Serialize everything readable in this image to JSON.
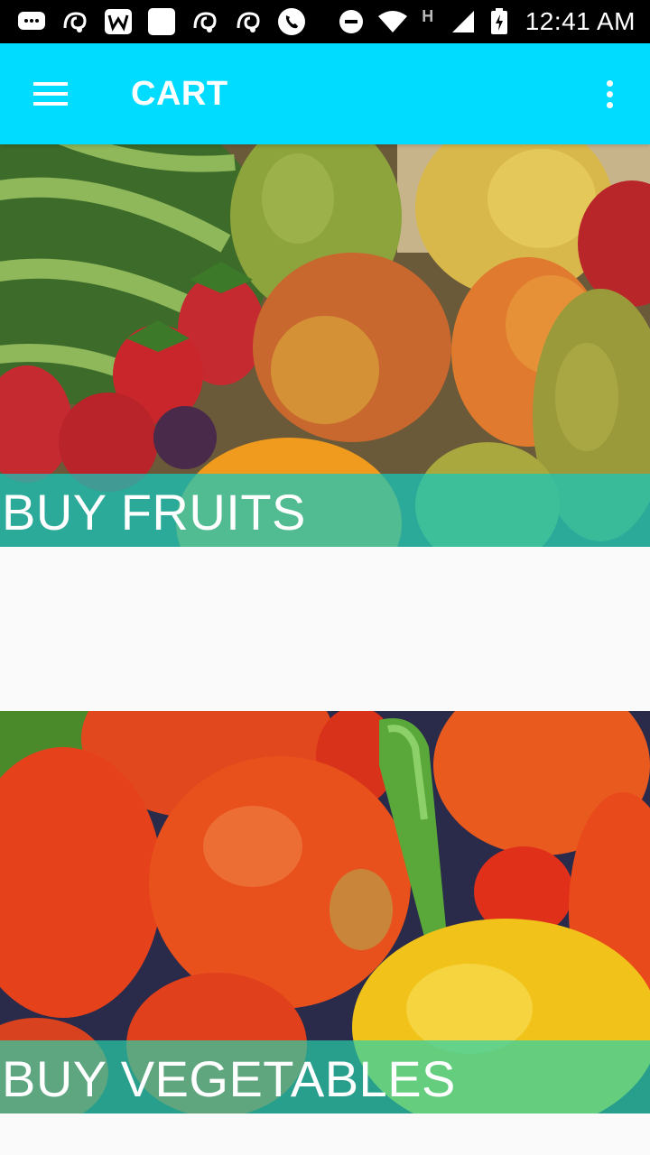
{
  "status_bar": {
    "time": "12:41 AM",
    "network_label": "H"
  },
  "app_bar": {
    "title": "CART"
  },
  "categories": [
    {
      "label": "BUY FRUITS"
    },
    {
      "label": "BUY VEGETABLES"
    }
  ],
  "colors": {
    "app_bar": "#00dcff",
    "banner_overlay": "#14c8be",
    "background": "#fafafa"
  }
}
